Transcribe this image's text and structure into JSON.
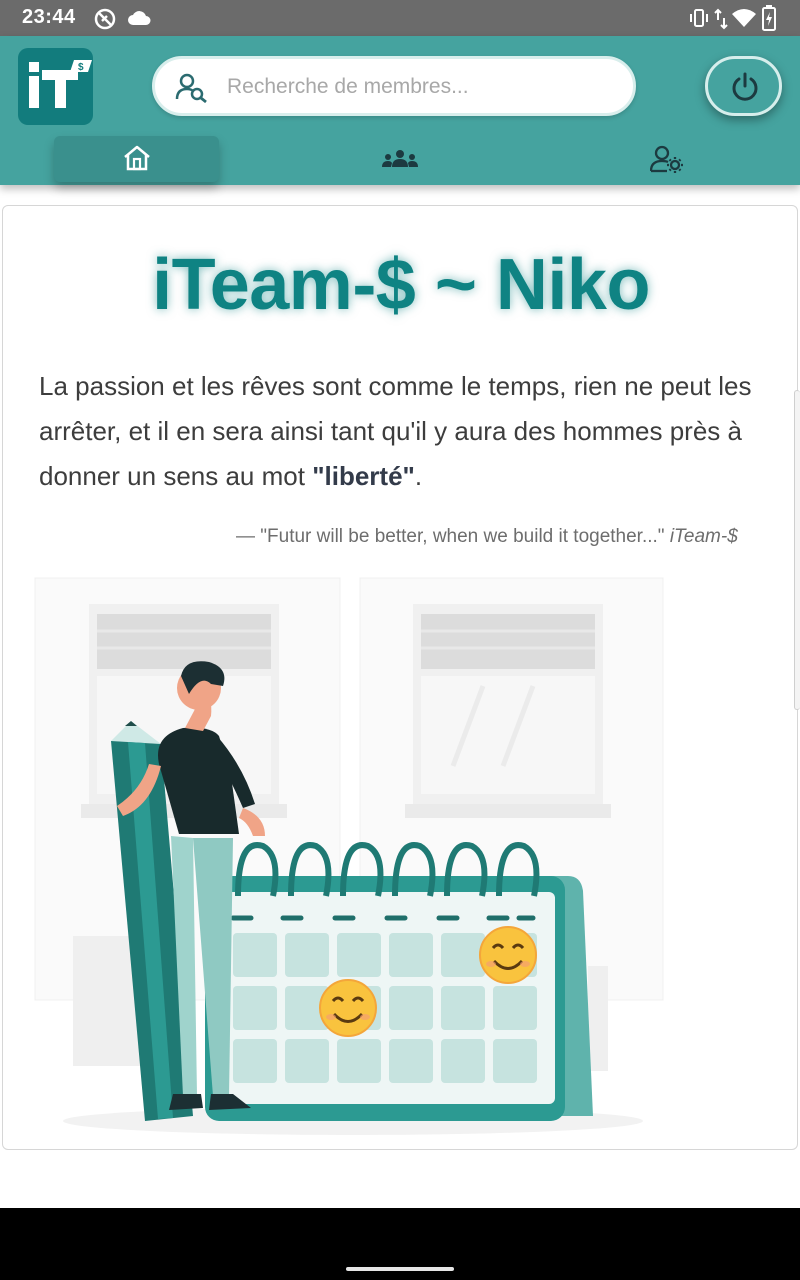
{
  "status_bar": {
    "time": "23:44",
    "icons": [
      "do-not-disturb-icon",
      "cloud-icon",
      "vibrate-icon",
      "data-arrows-icon",
      "wifi-icon",
      "battery-charging-icon"
    ]
  },
  "header": {
    "logo_text": "IT$",
    "search": {
      "placeholder": "Recherche de membres...",
      "value": ""
    },
    "power_icon": "power-icon",
    "tabs": [
      {
        "icon": "home-icon",
        "active": true
      },
      {
        "icon": "members-group-icon",
        "active": false
      },
      {
        "icon": "user-settings-icon",
        "active": false
      }
    ]
  },
  "main": {
    "title": "iTeam-$ ~ Niko",
    "paragraph_start": "La passion et les rêves sont comme le temps, rien ne peut les arrêter, et il en sera ainsi tant qu'il y aura des hommes près à donner un sens au mot ",
    "paragraph_bold": "\"liberté\"",
    "paragraph_end": ".",
    "quote_text": "—  \"Futur will be better, when we build it together...\" ",
    "quote_source": "iTeam-$",
    "illustration": "man-with-pencil-and-calendar-illustration"
  },
  "colors": {
    "primary": "#45a39f",
    "title": "#0f8383",
    "status_bar": "#6b6b6b",
    "logo_bg": "#127c7d"
  }
}
